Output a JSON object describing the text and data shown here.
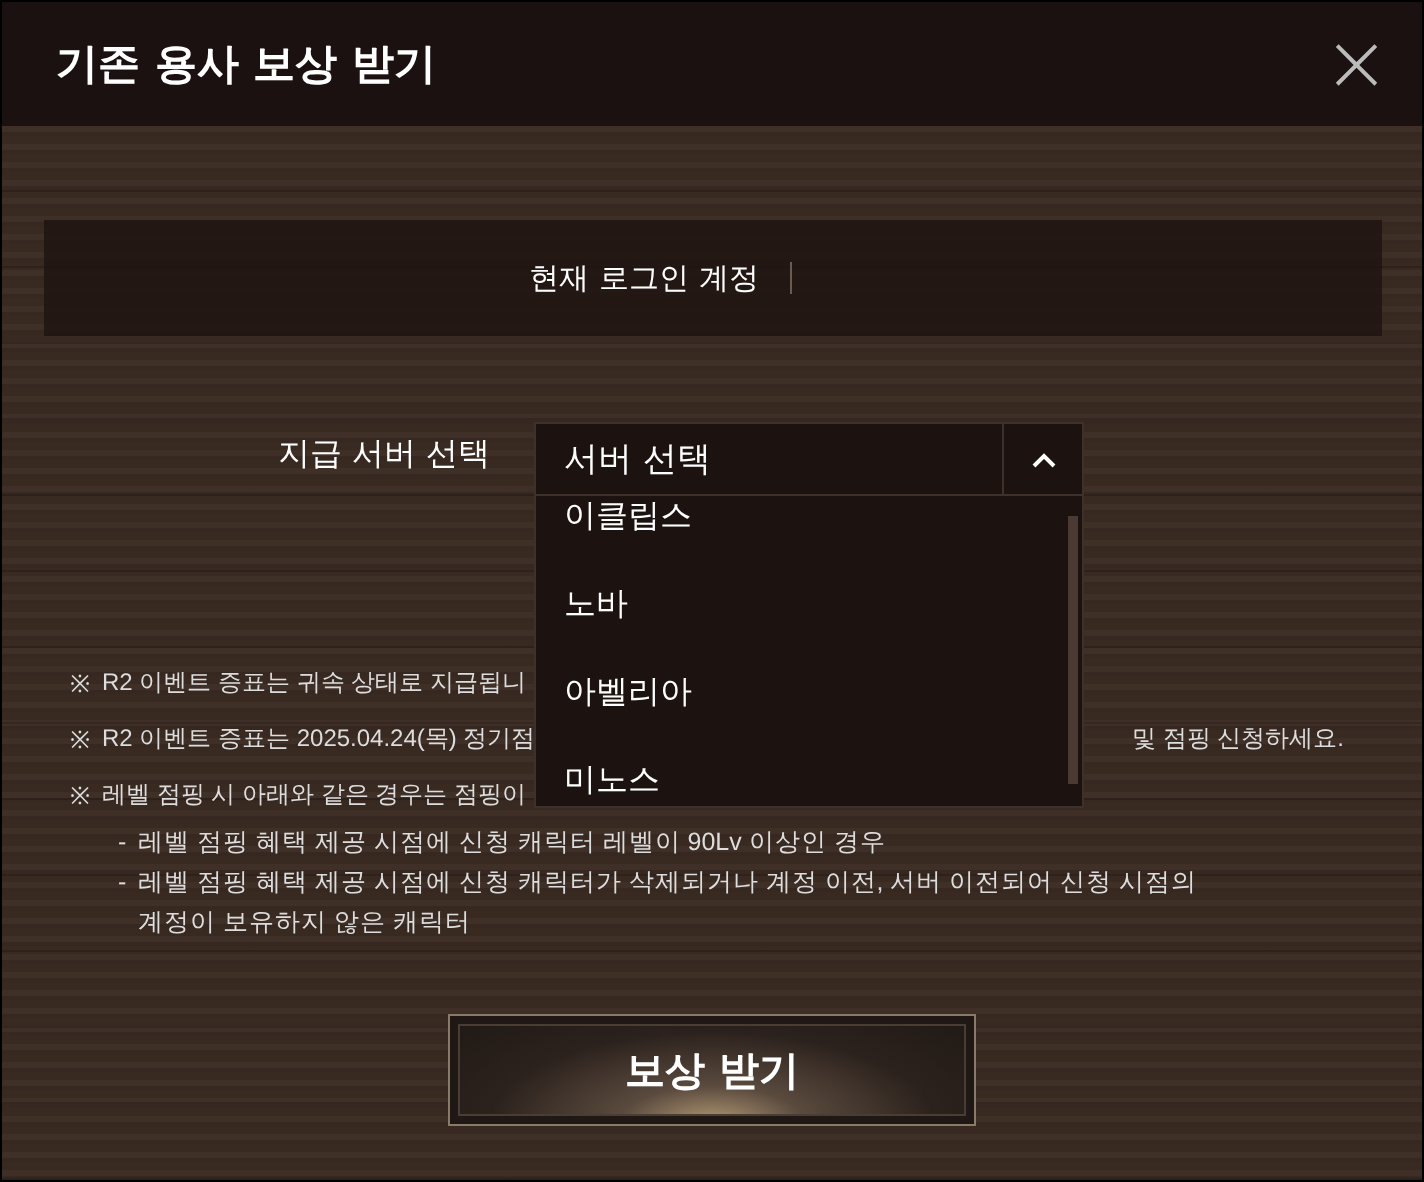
{
  "window": {
    "title": "기존 용사 보상 받기",
    "close": "×"
  },
  "account": {
    "label": "현재 로그인 계정"
  },
  "server_select": {
    "label": "지급 서버 선택",
    "value": "서버 선택",
    "expanded": true,
    "options": [
      {
        "label": "이클립스"
      },
      {
        "label": "노바"
      },
      {
        "label": "아벨리아"
      },
      {
        "label": "미노스"
      }
    ]
  },
  "notes": [
    {
      "mark": "※",
      "text": "R2 이벤트 증표는 귀속 상태로 지급됩니"
    },
    {
      "mark": "※",
      "text": "R2 이벤트 증표는 2025.04.24(목) 정기점",
      "text_right": "및 점핑 신청하세요."
    },
    {
      "mark": "※",
      "text": "레벨 점핑 시 아래와 같은 경우는 점핑이"
    }
  ],
  "sub_notes": [
    {
      "mark": "-",
      "text": "레벨 점핑 혜택 제공 시점에 신청 캐릭터 레벨이 90Lv 이상인 경우"
    },
    {
      "mark": "-",
      "text": "레벨 점핑 혜택 제공 시점에 신청 캐릭터가 삭제되거나 계정 이전, 서버 이전되어 신청 시점의 계정이 보유하지 않은 캐릭터"
    }
  ],
  "submit_button": "보상 받기"
}
